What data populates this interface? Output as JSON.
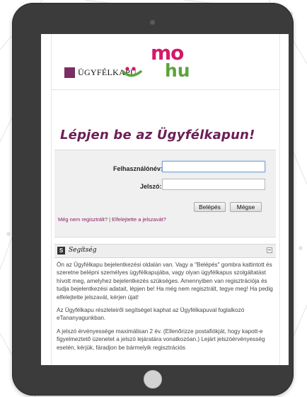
{
  "header": {
    "brand_text": "ÜGYFÉLKAPU",
    "logo_mo": "mo",
    "logo_hu": "hu"
  },
  "title": "Lépjen be az Ügyfélkapun!",
  "login": {
    "username_label": "Felhasználónév:",
    "username_value": "",
    "password_label": "Jelszó:",
    "password_value": "",
    "login_button": "Belépés",
    "cancel_button": "Mégse",
    "register_link": "Még nem regisztrált?",
    "separator": " | ",
    "forgot_link": "Elfelejtette a jelszavát?"
  },
  "help": {
    "badge": "S",
    "title": "Segítség",
    "paragraphs": [
      "Ön az Ügyfélkapu bejelentkezési oldalán van. Vagy a \"Belépés\" gombra kattintott és szeretne belépni személyes ügyfélkapujába, vagy olyan ügyfélkapus szolgáltatást hívott meg, amelyhez bejelentkezés szükséges. Amennyiben van regisztrációja és tudja bejelentkezési adatait, lépjen be! Ha még nem regisztrált, tegye meg! Ha pedig elfelejtette jelszavát, kérjen újat!",
      "Az Ügyfélkapu részleteiről segítséget kaphat az Ügyfélkapuval foglalkozó eTananyagunkban.",
      "A jelszó érvényessége maximálisan 2 év. (Ellenőrizze postafiókját, hogy kapott-e figyelmeztető üzenetet a jelszó lejáratára vonatkozóan.) Lejárt jelszóérvényesség esetén, kérjük, fáradjon be bármelyik regisztrációs"
    ]
  },
  "colors": {
    "tablet_frame": "#3b3b3b",
    "title": "#6b1f56",
    "brand_square": "#7b2e63",
    "logo_pink": "#d4186a",
    "logo_green": "#5ba33b",
    "link": "#8a1f63"
  }
}
